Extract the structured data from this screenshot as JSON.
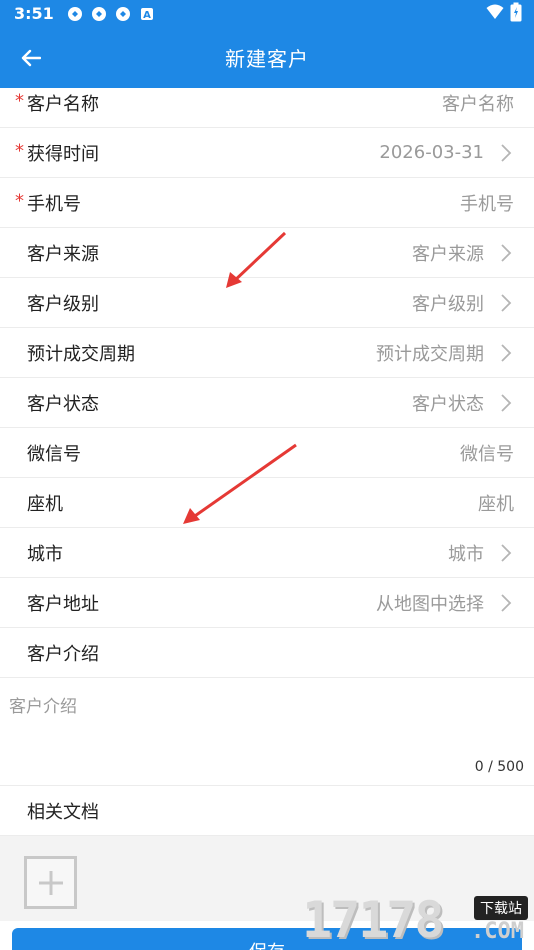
{
  "status_bar": {
    "time": "3:51",
    "notification_icons": [
      "sync-icon",
      "sync-icon",
      "sync-icon",
      "a-badge-icon"
    ],
    "right_icons": [
      "wifi-icon",
      "battery-icon"
    ]
  },
  "header": {
    "title": "新建客户",
    "back_icon": "arrow-left-icon",
    "color": "#1e88e5"
  },
  "form": {
    "fields": [
      {
        "label": "客户名称",
        "required": true,
        "value": "客户名称",
        "chevron": false
      },
      {
        "label": "获得时间",
        "required": true,
        "value": "2026-03-31",
        "chevron": true
      },
      {
        "label": "手机号",
        "required": true,
        "value": "手机号",
        "chevron": false
      },
      {
        "label": "客户来源",
        "required": false,
        "value": "客户来源",
        "chevron": true
      },
      {
        "label": "客户级别",
        "required": false,
        "value": "客户级别",
        "chevron": true
      },
      {
        "label": "预计成交周期",
        "required": false,
        "value": "预计成交周期",
        "chevron": true
      },
      {
        "label": "客户状态",
        "required": false,
        "value": "客户状态",
        "chevron": true
      },
      {
        "label": "微信号",
        "required": false,
        "value": "微信号",
        "chevron": false
      },
      {
        "label": "座机",
        "required": false,
        "value": "座机",
        "chevron": false
      },
      {
        "label": "城市",
        "required": false,
        "value": "城市",
        "chevron": true
      },
      {
        "label": "客户地址",
        "required": false,
        "value": "从地图中选择",
        "chevron": true
      },
      {
        "label": "客户介绍",
        "required": false,
        "value": "",
        "chevron": false
      }
    ],
    "required_mark": "*",
    "intro": {
      "placeholder": "客户介绍",
      "counter": "0 / 500"
    },
    "docs": {
      "label": "相关文档",
      "add_icon": "plus-icon"
    }
  },
  "save_label": "保存",
  "watermark": {
    "digits": "17178",
    "tag": "下载站",
    "suffix": ".COM"
  }
}
